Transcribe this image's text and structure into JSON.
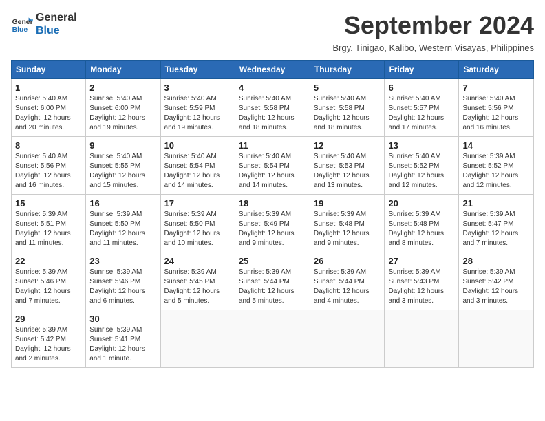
{
  "logo": {
    "line1": "General",
    "line2": "Blue"
  },
  "title": "September 2024",
  "subtitle": "Brgy. Tinigao, Kalibo, Western Visayas, Philippines",
  "days_of_week": [
    "Sunday",
    "Monday",
    "Tuesday",
    "Wednesday",
    "Thursday",
    "Friday",
    "Saturday"
  ],
  "weeks": [
    [
      {
        "day": "1",
        "info": "Sunrise: 5:40 AM\nSunset: 6:00 PM\nDaylight: 12 hours\nand 20 minutes."
      },
      {
        "day": "2",
        "info": "Sunrise: 5:40 AM\nSunset: 6:00 PM\nDaylight: 12 hours\nand 19 minutes."
      },
      {
        "day": "3",
        "info": "Sunrise: 5:40 AM\nSunset: 5:59 PM\nDaylight: 12 hours\nand 19 minutes."
      },
      {
        "day": "4",
        "info": "Sunrise: 5:40 AM\nSunset: 5:58 PM\nDaylight: 12 hours\nand 18 minutes."
      },
      {
        "day": "5",
        "info": "Sunrise: 5:40 AM\nSunset: 5:58 PM\nDaylight: 12 hours\nand 18 minutes."
      },
      {
        "day": "6",
        "info": "Sunrise: 5:40 AM\nSunset: 5:57 PM\nDaylight: 12 hours\nand 17 minutes."
      },
      {
        "day": "7",
        "info": "Sunrise: 5:40 AM\nSunset: 5:56 PM\nDaylight: 12 hours\nand 16 minutes."
      }
    ],
    [
      {
        "day": "8",
        "info": "Sunrise: 5:40 AM\nSunset: 5:56 PM\nDaylight: 12 hours\nand 16 minutes."
      },
      {
        "day": "9",
        "info": "Sunrise: 5:40 AM\nSunset: 5:55 PM\nDaylight: 12 hours\nand 15 minutes."
      },
      {
        "day": "10",
        "info": "Sunrise: 5:40 AM\nSunset: 5:54 PM\nDaylight: 12 hours\nand 14 minutes."
      },
      {
        "day": "11",
        "info": "Sunrise: 5:40 AM\nSunset: 5:54 PM\nDaylight: 12 hours\nand 14 minutes."
      },
      {
        "day": "12",
        "info": "Sunrise: 5:40 AM\nSunset: 5:53 PM\nDaylight: 12 hours\nand 13 minutes."
      },
      {
        "day": "13",
        "info": "Sunrise: 5:40 AM\nSunset: 5:52 PM\nDaylight: 12 hours\nand 12 minutes."
      },
      {
        "day": "14",
        "info": "Sunrise: 5:39 AM\nSunset: 5:52 PM\nDaylight: 12 hours\nand 12 minutes."
      }
    ],
    [
      {
        "day": "15",
        "info": "Sunrise: 5:39 AM\nSunset: 5:51 PM\nDaylight: 12 hours\nand 11 minutes."
      },
      {
        "day": "16",
        "info": "Sunrise: 5:39 AM\nSunset: 5:50 PM\nDaylight: 12 hours\nand 11 minutes."
      },
      {
        "day": "17",
        "info": "Sunrise: 5:39 AM\nSunset: 5:50 PM\nDaylight: 12 hours\nand 10 minutes."
      },
      {
        "day": "18",
        "info": "Sunrise: 5:39 AM\nSunset: 5:49 PM\nDaylight: 12 hours\nand 9 minutes."
      },
      {
        "day": "19",
        "info": "Sunrise: 5:39 AM\nSunset: 5:48 PM\nDaylight: 12 hours\nand 9 minutes."
      },
      {
        "day": "20",
        "info": "Sunrise: 5:39 AM\nSunset: 5:48 PM\nDaylight: 12 hours\nand 8 minutes."
      },
      {
        "day": "21",
        "info": "Sunrise: 5:39 AM\nSunset: 5:47 PM\nDaylight: 12 hours\nand 7 minutes."
      }
    ],
    [
      {
        "day": "22",
        "info": "Sunrise: 5:39 AM\nSunset: 5:46 PM\nDaylight: 12 hours\nand 7 minutes."
      },
      {
        "day": "23",
        "info": "Sunrise: 5:39 AM\nSunset: 5:46 PM\nDaylight: 12 hours\nand 6 minutes."
      },
      {
        "day": "24",
        "info": "Sunrise: 5:39 AM\nSunset: 5:45 PM\nDaylight: 12 hours\nand 5 minutes."
      },
      {
        "day": "25",
        "info": "Sunrise: 5:39 AM\nSunset: 5:44 PM\nDaylight: 12 hours\nand 5 minutes."
      },
      {
        "day": "26",
        "info": "Sunrise: 5:39 AM\nSunset: 5:44 PM\nDaylight: 12 hours\nand 4 minutes."
      },
      {
        "day": "27",
        "info": "Sunrise: 5:39 AM\nSunset: 5:43 PM\nDaylight: 12 hours\nand 3 minutes."
      },
      {
        "day": "28",
        "info": "Sunrise: 5:39 AM\nSunset: 5:42 PM\nDaylight: 12 hours\nand 3 minutes."
      }
    ],
    [
      {
        "day": "29",
        "info": "Sunrise: 5:39 AM\nSunset: 5:42 PM\nDaylight: 12 hours\nand 2 minutes."
      },
      {
        "day": "30",
        "info": "Sunrise: 5:39 AM\nSunset: 5:41 PM\nDaylight: 12 hours\nand 1 minute."
      },
      {
        "day": "",
        "info": ""
      },
      {
        "day": "",
        "info": ""
      },
      {
        "day": "",
        "info": ""
      },
      {
        "day": "",
        "info": ""
      },
      {
        "day": "",
        "info": ""
      }
    ]
  ]
}
